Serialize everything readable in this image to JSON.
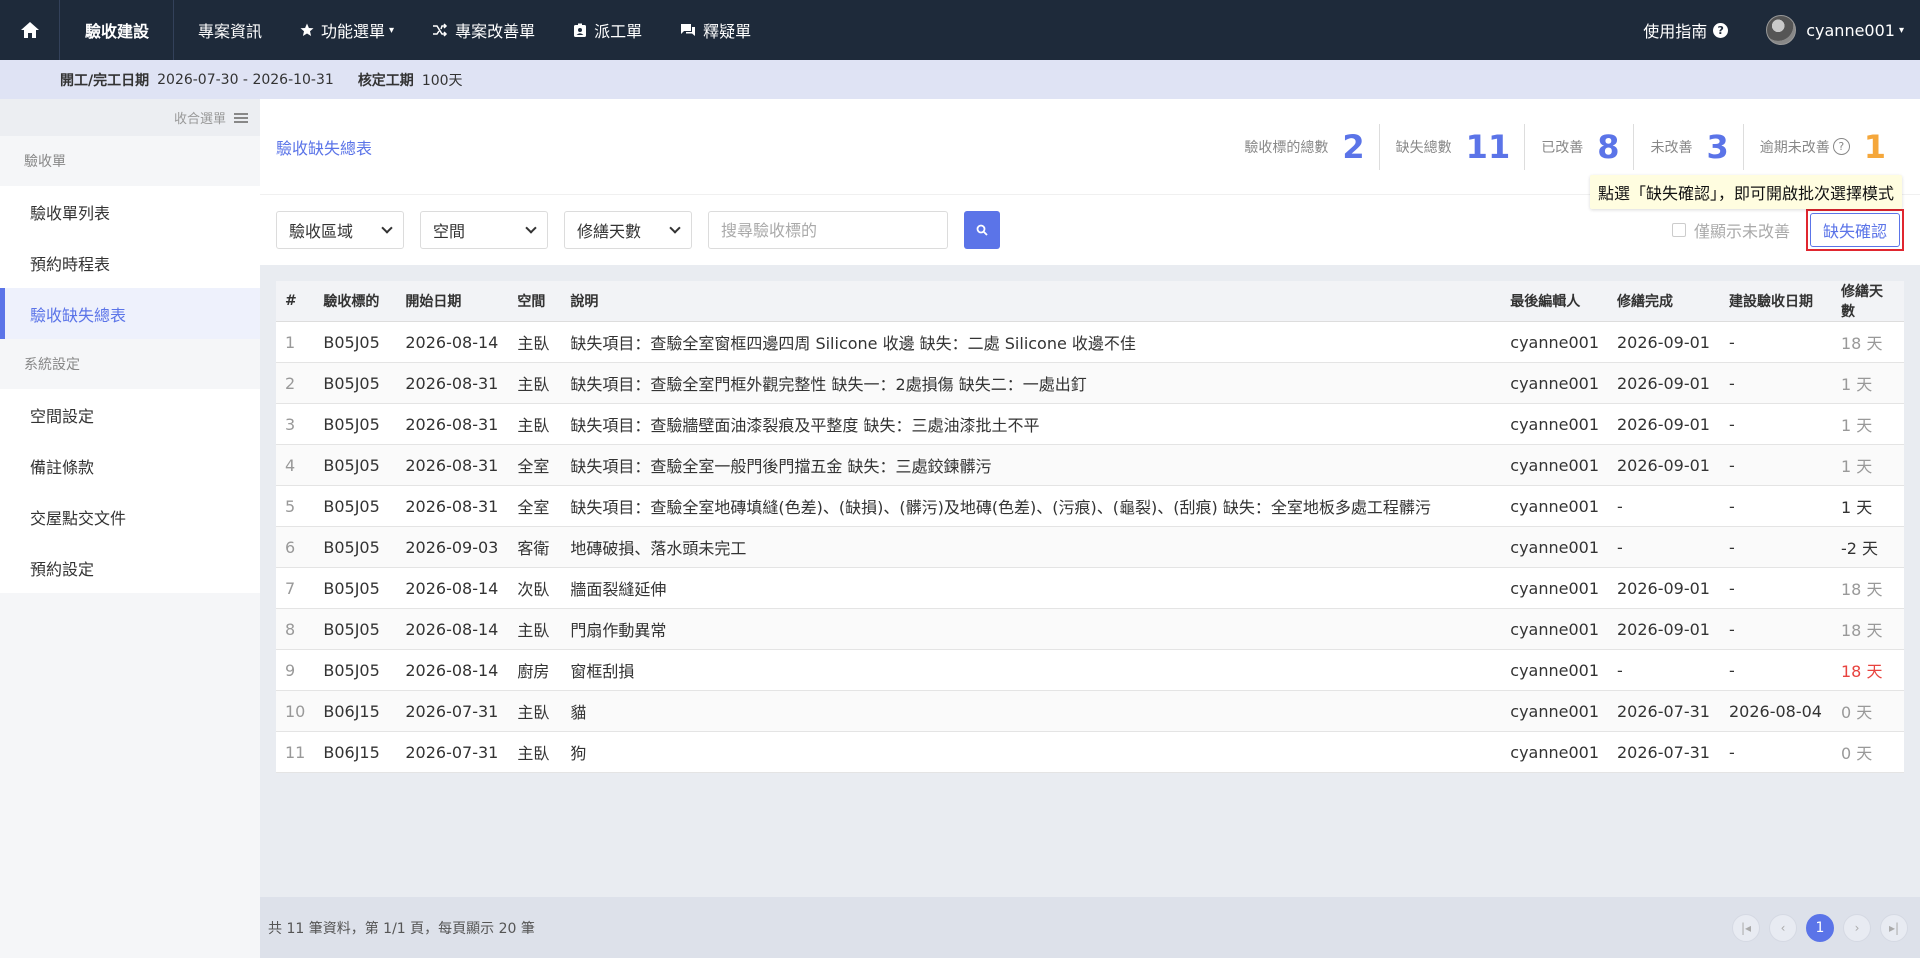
{
  "nav": {
    "brand": "驗收建設",
    "items": [
      {
        "label": "專案資訊",
        "icon": ""
      },
      {
        "label": "功能選單",
        "icon": "star-icon",
        "dropdown": true
      },
      {
        "label": "專案改善單",
        "icon": "shuffle-icon"
      },
      {
        "label": "派工單",
        "icon": "badge-icon"
      },
      {
        "label": "釋疑單",
        "icon": "chat-icon"
      }
    ],
    "guide": "使用指南",
    "user": "cyanne001"
  },
  "info": {
    "date_label": "開工/完工日期",
    "date_value": "2026-07-30 - 2026-10-31",
    "period_label": "核定工期",
    "period_value": "100天"
  },
  "sidebar": {
    "collapse_label": "收合選單",
    "groups": [
      {
        "title": "驗收單",
        "items": [
          "驗收單列表",
          "預約時程表",
          "驗收缺失總表"
        ]
      },
      {
        "title": "系統設定",
        "items": [
          "空間設定",
          "備註條款",
          "交屋點交文件",
          "預約設定"
        ]
      }
    ],
    "active": "驗收缺失總表"
  },
  "summary": {
    "title": "驗收缺失總表",
    "stats": [
      {
        "label": "驗收標的總數",
        "value": "2"
      },
      {
        "label": "缺失總數",
        "value": "11"
      },
      {
        "label": "已改善",
        "value": "8"
      },
      {
        "label": "未改善",
        "value": "3"
      },
      {
        "label": "逾期未改善",
        "value": "1",
        "color": "#f5a73b"
      }
    ]
  },
  "tooltip": "點選「缺失確認」，即可開啟批次選擇模式",
  "filters": {
    "area": "驗收區域",
    "space": "空間",
    "days": "修繕天數",
    "search_placeholder": "搜尋驗收標的",
    "only_unimproved": "僅顯示未改善",
    "confirm": "缺失確認"
  },
  "table": {
    "headers": [
      "#",
      "驗收標的",
      "開始日期",
      "空間",
      "說明",
      "最後編輯人",
      "修繕完成",
      "建設驗收日期",
      "修繕天數"
    ],
    "rows": [
      [
        "1",
        "B05J05",
        "2026-08-14",
        "主臥",
        "缺失項目：查驗全室窗框四邊四周 Silicone 收邊 缺失：二處 Silicone 收邊不佳",
        "cyanne001",
        "2026-09-01",
        "-",
        "18 天"
      ],
      [
        "2",
        "B05J05",
        "2026-08-31",
        "主臥",
        "缺失項目：查驗全室門框外觀完整性 缺失一：2處損傷 缺失二：一處出釘",
        "cyanne001",
        "2026-09-01",
        "-",
        "1 天"
      ],
      [
        "3",
        "B05J05",
        "2026-08-31",
        "主臥",
        "缺失項目：查驗牆壁面油漆裂痕及平整度 缺失：三處油漆批土不平",
        "cyanne001",
        "2026-09-01",
        "-",
        "1 天"
      ],
      [
        "4",
        "B05J05",
        "2026-08-31",
        "全室",
        "缺失項目：查驗全室一般門後門擋五金 缺失：三處鉸鍊髒污",
        "cyanne001",
        "2026-09-01",
        "-",
        "1 天"
      ],
      [
        "5",
        "B05J05",
        "2026-08-31",
        "全室",
        "缺失項目：查驗全室地磚填縫(色差)、(缺損)、(髒污)及地磚(色差)、(污痕)、(龜裂)、(刮痕) 缺失：全室地板多處工程髒污",
        "cyanne001",
        "-",
        "-",
        "1 天"
      ],
      [
        "6",
        "B05J05",
        "2026-09-03",
        "客衛",
        "地磚破損、落水頭未完工",
        "cyanne001",
        "-",
        "-",
        "-2 天"
      ],
      [
        "7",
        "B05J05",
        "2026-08-14",
        "次臥",
        "牆面裂縫延伸",
        "cyanne001",
        "2026-09-01",
        "-",
        "18 天"
      ],
      [
        "8",
        "B05J05",
        "2026-08-14",
        "主臥",
        "門扇作動異常",
        "cyanne001",
        "2026-09-01",
        "-",
        "18 天"
      ],
      [
        "9",
        "B05J05",
        "2026-08-14",
        "廚房",
        "窗框刮損",
        "cyanne001",
        "-",
        "-",
        "18 天"
      ],
      [
        "10",
        "B06J15",
        "2026-07-31",
        "主臥",
        "貓",
        "cyanne001",
        "2026-07-31",
        "2026-08-04",
        "0 天"
      ],
      [
        "11",
        "B06J15",
        "2026-07-31",
        "主臥",
        "狗",
        "cyanne001",
        "2026-07-31",
        "-",
        "0 天"
      ]
    ],
    "day_status": [
      "done",
      "done",
      "done",
      "done",
      "open",
      "open",
      "done",
      "done",
      "overdue",
      "done",
      "done"
    ]
  },
  "footer": {
    "summary": "共 11 筆資料，第 1/1 頁，每頁顯示 20 筆",
    "current_page": "1"
  },
  "colors": {
    "accent": "#5b74e8",
    "nav_bg": "#1e2a3a",
    "overdue": "#e8433f",
    "orange": "#f5a73b"
  }
}
